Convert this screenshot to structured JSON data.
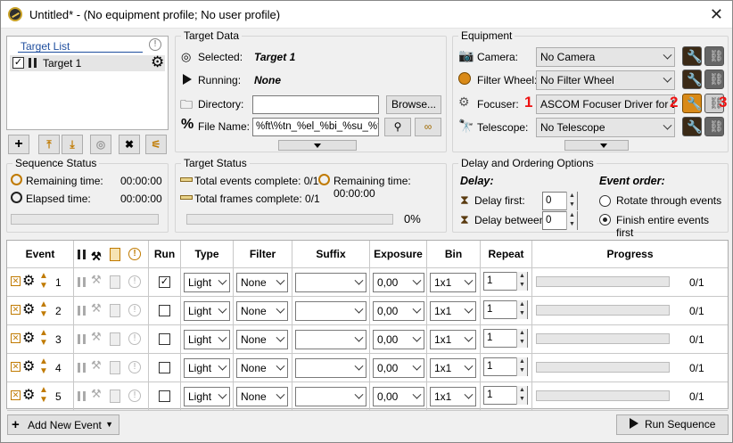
{
  "window": {
    "title": "Untitled* - (No equipment profile; No user profile)"
  },
  "target_list": {
    "title": "Target List",
    "items": [
      {
        "label": "Target 1",
        "checked": true
      }
    ]
  },
  "target_data": {
    "title": "Target Data",
    "selected_label": "Selected:",
    "selected_value": "Target 1",
    "running_label": "Running:",
    "running_value": "None",
    "directory_label": "Directory:",
    "directory_value": "",
    "browse_label": "Browse...",
    "filename_label": "File Name:",
    "filename_value": "%ft\\%tn_%el_%bi_%su_%fn"
  },
  "equipment": {
    "title": "Equipment",
    "camera_label": "Camera:",
    "camera_value": "No Camera",
    "filter_wheel_label": "Filter Wheel:",
    "filter_wheel_value": "No Filter Wheel",
    "focuser_label": "Focuser:",
    "focuser_value": "ASCOM Focuser Driver for D",
    "telescope_label": "Telescope:",
    "telescope_value": "No Telescope",
    "annotations": [
      "1",
      "2",
      "3"
    ]
  },
  "sequence_status": {
    "title": "Sequence Status",
    "remaining_label": "Remaining time:",
    "remaining_value": "00:00:00",
    "elapsed_label": "Elapsed time:",
    "elapsed_value": "00:00:00"
  },
  "target_status": {
    "title": "Target Status",
    "events_label": "Total events complete: 0/1",
    "frames_label": "Total frames complete: 0/1",
    "remaining_label": "Remaining time: 00:00:00",
    "percent": "0%"
  },
  "delay": {
    "title": "Delay and Ordering Options",
    "delay_heading": "Delay:",
    "delay_first_label": "Delay first:",
    "delay_first_value": "0",
    "delay_between_label": "Delay between:",
    "delay_between_value": "0",
    "order_heading": "Event order:",
    "rotate_label": "Rotate through events",
    "finish_label": "Finish entire events first",
    "selected_order": "finish"
  },
  "table": {
    "headers": [
      "Event",
      "Run",
      "Type",
      "Filter",
      "Suffix",
      "Exposure",
      "Bin",
      "Repeat",
      "Progress"
    ],
    "rows": [
      {
        "num": "1",
        "run": true,
        "type": "Light",
        "filter": "None",
        "suffix": "",
        "exposure": "0,00",
        "bin": "1x1",
        "repeat": "1",
        "progress": "0/1"
      },
      {
        "num": "2",
        "run": false,
        "type": "Light",
        "filter": "None",
        "suffix": "",
        "exposure": "0,00",
        "bin": "1x1",
        "repeat": "1",
        "progress": "0/1"
      },
      {
        "num": "3",
        "run": false,
        "type": "Light",
        "filter": "None",
        "suffix": "",
        "exposure": "0,00",
        "bin": "1x1",
        "repeat": "1",
        "progress": "0/1"
      },
      {
        "num": "4",
        "run": false,
        "type": "Light",
        "filter": "None",
        "suffix": "",
        "exposure": "0,00",
        "bin": "1x1",
        "repeat": "1",
        "progress": "0/1"
      },
      {
        "num": "5",
        "run": false,
        "type": "Light",
        "filter": "None",
        "suffix": "",
        "exposure": "0,00",
        "bin": "1x1",
        "repeat": "1",
        "progress": "0/1"
      }
    ]
  },
  "footer": {
    "add_event_label": "Add New Event",
    "run_sequence_label": "Run Sequence"
  },
  "colors": {
    "accent": "#d98a18",
    "annotation": "#ee1111"
  }
}
